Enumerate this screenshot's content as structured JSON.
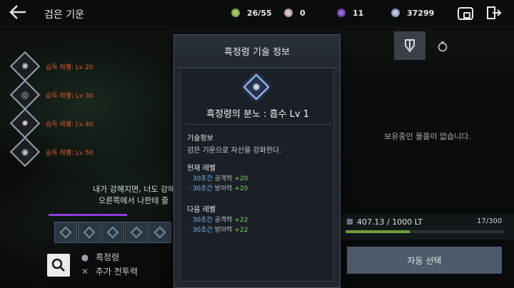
{
  "header": {
    "title": "검은 기운",
    "currencies": [
      {
        "value": "26/55",
        "color": "#8fbf50"
      },
      {
        "value": "0",
        "color": "#c7a8b2"
      },
      {
        "value": "11",
        "color": "#7a3fd0"
      },
      {
        "value": "37299",
        "color": "#9aa6d0"
      }
    ]
  },
  "skills": [
    {
      "label": "습득 레벨: Lv 20"
    },
    {
      "label": "습득 레벨: Lv 30"
    },
    {
      "label": "습득 레벨: Lv 40"
    },
    {
      "label": "습득 레벨: Lv 50"
    }
  ],
  "hint": {
    "line1": "내가 강해지면, 너도 강해",
    "line2": "오른쪽에서 나한테 줄"
  },
  "filters": {
    "item1": "흑정령",
    "item2": "추가 전투력"
  },
  "right_panel": {
    "empty_message": "보유중인 물품이 없습니다.",
    "weight": "407.13 / 1000 LT",
    "weight_fraction": 0.407,
    "slot_count": "17/300",
    "auto_button": "자동 선택"
  },
  "modal": {
    "title": "흑정령 기술 정보",
    "skill_name": "흑정령의 분노 : 흡수 Lv 1",
    "info_title": "기술정보",
    "info_desc": "검은 기운으로 자신을 강화한다.",
    "current_title": "현재 레벨",
    "current_stats": [
      {
        "duration": "30초간",
        "stat": "공격력",
        "bonus": "+20"
      },
      {
        "duration": "30초간",
        "stat": "방어력",
        "bonus": "+20"
      }
    ],
    "next_title": "다음 레벨",
    "next_stats": [
      {
        "duration": "30초간",
        "stat": "공격력",
        "bonus": "+22"
      },
      {
        "duration": "30초간",
        "stat": "방어력",
        "bonus": "+22"
      }
    ]
  }
}
